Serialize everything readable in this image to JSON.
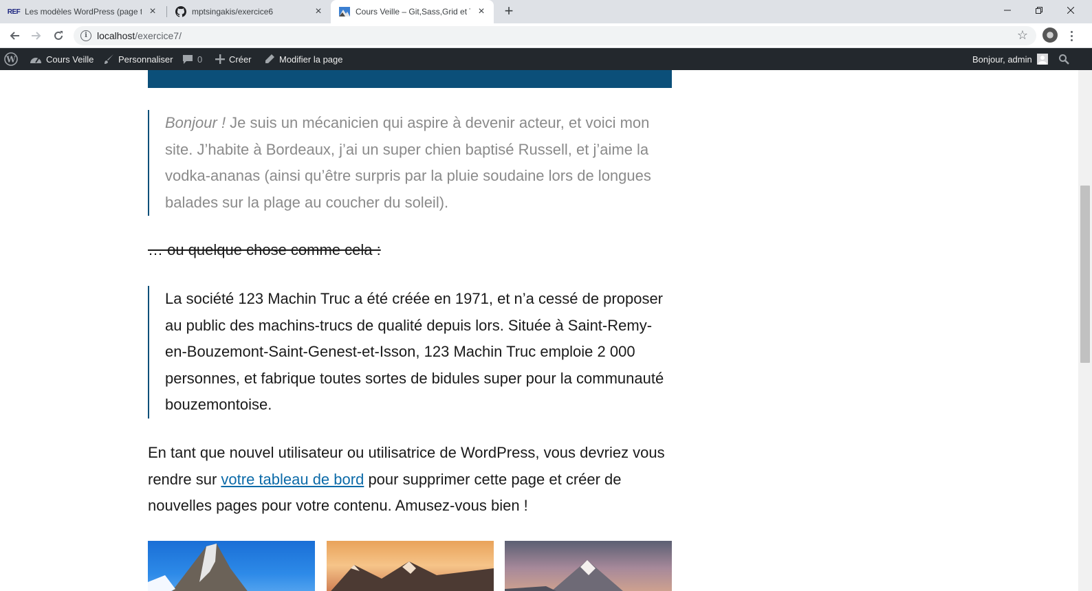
{
  "browser": {
    "tabs": [
      {
        "favicon": "ref-favicon",
        "title": "Les modèles WordPress (page te",
        "active": false
      },
      {
        "favicon": "github-icon",
        "title": "mptsingakis/exercice6",
        "active": false
      },
      {
        "favicon": "site-thumbnail-icon",
        "title": "Cours Veille – Git,Sass,Grid et Th",
        "active": true
      }
    ],
    "ref_favicon_text": "REF",
    "new_tab_glyph": "+",
    "url_host": "localhost",
    "url_path": "/exercice7/"
  },
  "adminbar": {
    "site_name": "Cours Veille",
    "customize": "Personnaliser",
    "comments_count": "0",
    "new": "Créer",
    "edit": "Modifier la page",
    "greeting": "Bonjour, admin"
  },
  "page": {
    "quote1_em": "Bonjour !",
    "quote1_text": " Je suis un mécanicien qui aspire à devenir acteur, et voici mon site. J’habite à Bordeaux, j’ai un super chien baptisé Russell, et j’aime la vodka-ananas (ainsi qu’être surpris par la pluie soudaine lors de longues balades sur la plage au coucher du soleil).",
    "strike_text": "… ou quelque chose comme cela :",
    "quote2_text": "La société 123 Machin Truc a été créée en 1971, et n’a cessé de proposer au public des machins-trucs de qualité depuis lors. Située à Saint-Remy-en-Bouzemont-Saint-Genest-et-Isson, 123 Machin Truc emploie 2 000 personnes, et fabrique toutes sortes de bidules super pour la communauté bouzemontoise.",
    "para_before": "En tant que nouvel utilisateur ou utilisatrice de WordPress, vous devriez vous rendre sur ",
    "para_link": "votre tableau de bord",
    "para_after": " pour supprimer cette page et créer de nouvelles pages pour votre contenu. Amusez-vous bien !"
  },
  "colors": {
    "accent": "#0b4f79",
    "link": "#0b6aa8",
    "adminbar_bg": "#23282d"
  }
}
